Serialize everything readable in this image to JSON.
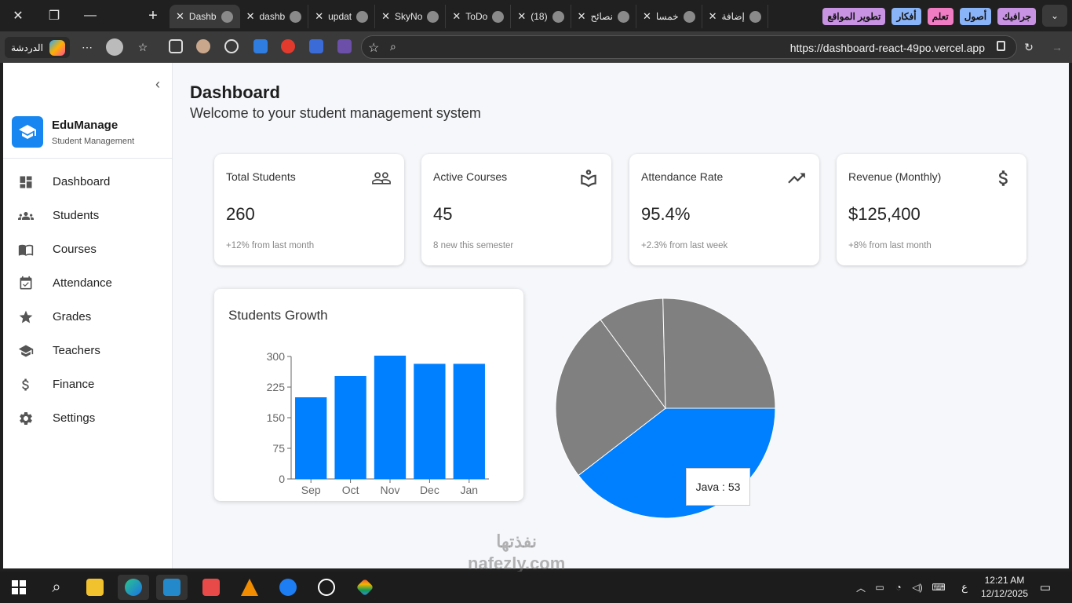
{
  "browser": {
    "tabs": [
      {
        "title": "Dashb",
        "active": true
      },
      {
        "title": "dashb"
      },
      {
        "title": "updat"
      },
      {
        "title": "SkyNo"
      },
      {
        "title": "ToDo"
      },
      {
        "title": "(18)"
      },
      {
        "title": "نصائح"
      },
      {
        "title": "خمسا"
      },
      {
        "title": "إضافة"
      }
    ],
    "tab_groups": [
      {
        "label": "تطوير المواقع",
        "color": "#c893e3"
      },
      {
        "label": "أفكار",
        "color": "#8ab4f8"
      },
      {
        "label": "تعلم",
        "color": "#f07cc4"
      },
      {
        "label": "أصول",
        "color": "#8ab4f8"
      },
      {
        "label": "جرافيك",
        "color": "#c893e3"
      }
    ],
    "copilot_label": "الدردشة",
    "url": "https://dashboard-react-49po.vercel.app"
  },
  "sidebar": {
    "brand_name": "EduManage",
    "brand_sub": "Student Management",
    "items": [
      {
        "label": "Dashboard",
        "icon": "dashboard-icon"
      },
      {
        "label": "Students",
        "icon": "students-icon"
      },
      {
        "label": "Courses",
        "icon": "courses-icon"
      },
      {
        "label": "Attendance",
        "icon": "attendance-icon"
      },
      {
        "label": "Grades",
        "icon": "grades-icon"
      },
      {
        "label": "Teachers",
        "icon": "teachers-icon"
      },
      {
        "label": "Finance",
        "icon": "finance-icon"
      },
      {
        "label": "Settings",
        "icon": "settings-icon"
      }
    ]
  },
  "header": {
    "title": "Dashboard",
    "subtitle": "Welcome to your student management system"
  },
  "stats": [
    {
      "title": "Total Students",
      "value": "260",
      "sub": "+12% from last month",
      "icon": "people-icon"
    },
    {
      "title": "Active Courses",
      "value": "45",
      "sub": "8 new this semester",
      "icon": "book-icon"
    },
    {
      "title": "Attendance Rate",
      "value": "95.4%",
      "sub": "+2.3% from last week",
      "icon": "trending-up-icon"
    },
    {
      "title": "Revenue (Monthly)",
      "value": "$125,400",
      "sub": "+8% from last month",
      "icon": "dollar-icon"
    }
  ],
  "chart_data": [
    {
      "type": "bar",
      "title": "Students Growth",
      "categories": [
        "Sep",
        "Oct",
        "Nov",
        "Dec",
        "Jan"
      ],
      "values": [
        200,
        252,
        302,
        282,
        282
      ],
      "yticks": [
        0,
        75,
        150,
        225,
        300
      ],
      "ylim": [
        0,
        300
      ],
      "color": "#0080ff",
      "grid": false
    },
    {
      "type": "pie",
      "slices": [
        {
          "label": "Java",
          "value": 53,
          "color": "#0080ff"
        },
        {
          "value": 34,
          "color": "#808080"
        },
        {
          "value": 13,
          "color": "#808080"
        },
        {
          "value": 34,
          "color": "#808080"
        }
      ],
      "tooltip": {
        "label": "Java",
        "value": 53,
        "text": "Java : 53"
      }
    }
  ],
  "taskbar": {
    "time": "12:21 AM",
    "date": "12/12/2025",
    "lang": "ع"
  },
  "watermark": {
    "line1": "نفذتها",
    "line2": "nafezly.com"
  }
}
